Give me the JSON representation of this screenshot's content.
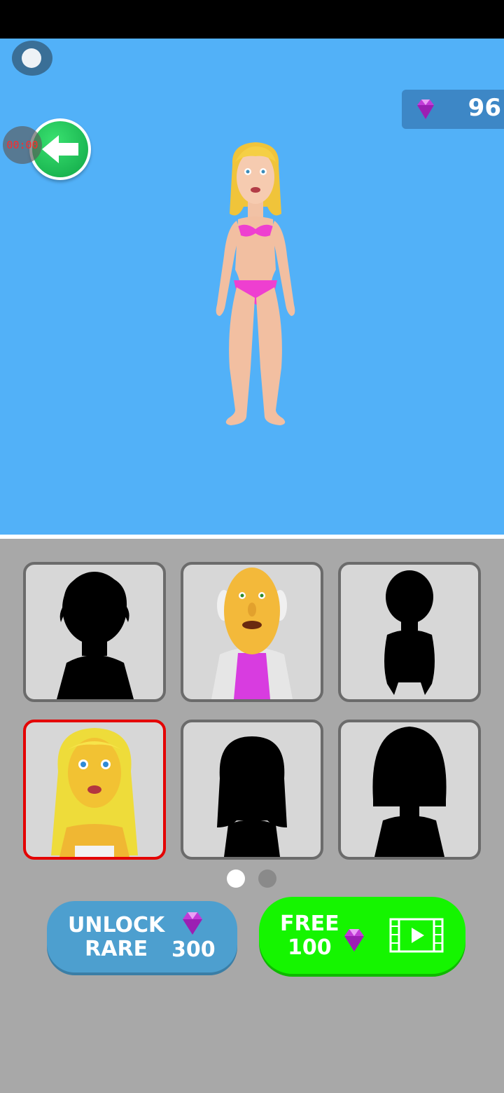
{
  "hud": {
    "timer": "00:00",
    "gems": "96"
  },
  "buttons": {
    "unlock_line1": "UNLOCK",
    "unlock_line2": "RARE",
    "unlock_price": "300",
    "free_line1": "FREE",
    "free_line2": "100"
  },
  "characters": [
    {
      "name": "silhouette-man",
      "locked": true
    },
    {
      "name": "old-man",
      "locked": false
    },
    {
      "name": "silhouette-baby",
      "locked": true
    },
    {
      "name": "blonde-woman",
      "locked": false,
      "selected": true
    },
    {
      "name": "silhouette-long-hair",
      "locked": true
    },
    {
      "name": "silhouette-bob-hair",
      "locked": true
    }
  ],
  "pagination": {
    "current": 1,
    "total": 2
  },
  "colors": {
    "sky": "#52b1f8",
    "selected_border": "#e40000",
    "free_button": "#15f500",
    "unlock_button": "#4d9fcf",
    "gem": "#c23ad8"
  },
  "icons": [
    "assistive-touch-icon",
    "back-arrow-icon",
    "gem-icon",
    "video-ad-icon"
  ]
}
